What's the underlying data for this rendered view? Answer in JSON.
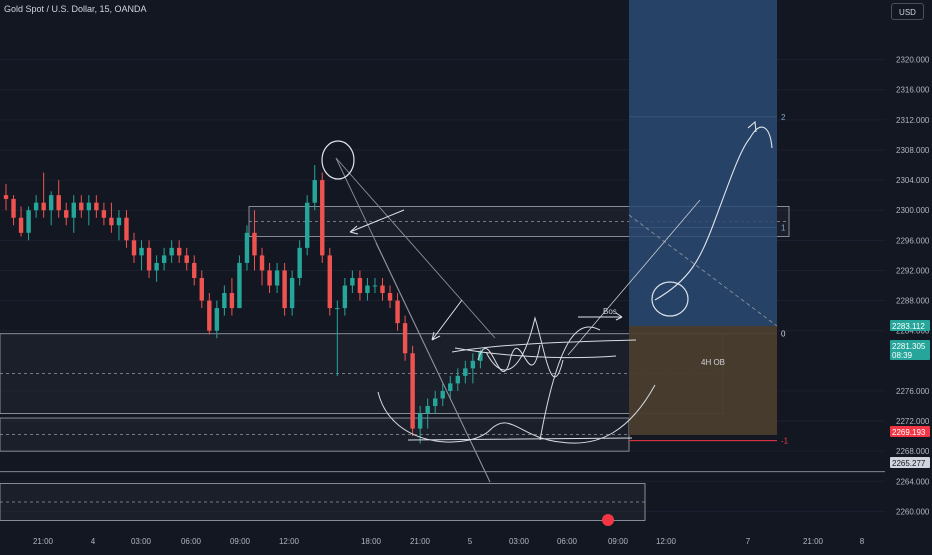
{
  "header": {
    "symbol_title": "Gold Spot / U.S. Dollar, 15, OANDA",
    "currency": "USD"
  },
  "chart_data": {
    "type": "candlestick",
    "title": "Gold Spot / U.S. Dollar, 15, OANDA",
    "y_axis": {
      "ticks": [
        "2320.000",
        "2316.000",
        "2312.000",
        "2308.000",
        "2304.000",
        "2300.000",
        "2296.000",
        "2292.000",
        "2288.000",
        "2284.000",
        "2276.000",
        "2272.000",
        "2268.000",
        "2264.000",
        "2260.000"
      ],
      "ylim": [
        2257,
        2325
      ]
    },
    "x_axis": {
      "ticks": [
        "21:00",
        "4",
        "03:00",
        "06:00",
        "09:00",
        "12:00",
        "18:00",
        "21:00",
        "5",
        "03:00",
        "06:00",
        "09:00",
        "12:00",
        "7",
        "21:00",
        "8"
      ]
    },
    "price_badges": [
      {
        "label": "2283.112",
        "color": "#26a69a"
      },
      {
        "label": "2281.305",
        "sub": "08:39",
        "color": "#26a69a"
      },
      {
        "label": "2269.193",
        "color": "#f23645"
      },
      {
        "label": "2265.277",
        "color": "#d1d4dc"
      }
    ],
    "candles": [
      [
        2302,
        2303.5,
        2300,
        2301.5
      ],
      [
        2301.5,
        2302,
        2298,
        2299
      ],
      [
        2299,
        2300.5,
        2296.5,
        2297
      ],
      [
        2297,
        2300.5,
        2296,
        2300
      ],
      [
        2300,
        2302,
        2299,
        2301
      ],
      [
        2301,
        2305,
        2299,
        2300
      ],
      [
        2300,
        2302.5,
        2298,
        2302
      ],
      [
        2302,
        2304,
        2299,
        2300
      ],
      [
        2300,
        2301,
        2298,
        2299
      ],
      [
        2299,
        2302,
        2297,
        2301
      ],
      [
        2301,
        2302,
        2299,
        2300
      ],
      [
        2300,
        2302,
        2298,
        2301
      ],
      [
        2301,
        2302,
        2299,
        2300
      ],
      [
        2300,
        2301,
        2298,
        2299
      ],
      [
        2299,
        2301,
        2297,
        2298
      ],
      [
        2298,
        2300,
        2296,
        2299
      ],
      [
        2299,
        2300,
        2295,
        2296
      ],
      [
        2296,
        2297,
        2293,
        2294
      ],
      [
        2294,
        2296,
        2292,
        2295
      ],
      [
        2295,
        2296,
        2291,
        2292
      ],
      [
        2292,
        2294,
        2290.5,
        2293
      ],
      [
        2293,
        2295,
        2292,
        2294
      ],
      [
        2294,
        2296,
        2293,
        2295
      ],
      [
        2295,
        2296,
        2293,
        2294
      ],
      [
        2294,
        2295,
        2292,
        2293
      ],
      [
        2293,
        2294,
        2290,
        2291
      ],
      [
        2291,
        2292,
        2287,
        2288
      ],
      [
        2288,
        2289,
        2283.5,
        2284
      ],
      [
        2284,
        2288,
        2283,
        2287
      ],
      [
        2287,
        2290,
        2286,
        2289
      ],
      [
        2289,
        2291,
        2286,
        2287
      ],
      [
        2287,
        2294,
        2287,
        2293
      ],
      [
        2293,
        2298,
        2292,
        2297
      ],
      [
        2297,
        2300,
        2292,
        2294
      ],
      [
        2294,
        2295,
        2290,
        2292
      ],
      [
        2292,
        2293,
        2289,
        2290
      ],
      [
        2290,
        2293,
        2289,
        2292
      ],
      [
        2292,
        2293,
        2286,
        2287
      ],
      [
        2287,
        2292,
        2286,
        2291
      ],
      [
        2291,
        2296,
        2290,
        2295
      ],
      [
        2295,
        2302,
        2294,
        2301
      ],
      [
        2301,
        2306,
        2300,
        2304
      ],
      [
        2304,
        2305,
        2293,
        2294
      ],
      [
        2294,
        2295,
        2286,
        2287
      ],
      [
        2287,
        2288,
        2278,
        2287
      ],
      [
        2287,
        2291,
        2286,
        2290
      ],
      [
        2290,
        2292,
        2289,
        2291
      ],
      [
        2291,
        2292,
        2288,
        2289
      ],
      [
        2289,
        2291,
        2288,
        2290
      ],
      [
        2290,
        2291,
        2289,
        2290
      ],
      [
        2290,
        2291,
        2288,
        2289
      ],
      [
        2289,
        2290,
        2287,
        2288
      ],
      [
        2288,
        2289,
        2284,
        2285
      ],
      [
        2285,
        2286,
        2280,
        2281
      ],
      [
        2281,
        2282,
        2270,
        2271
      ],
      [
        2271,
        2274,
        2269,
        2273
      ],
      [
        2273,
        2275,
        2271,
        2274
      ],
      [
        2274,
        2276,
        2273,
        2275
      ],
      [
        2275,
        2277,
        2274,
        2276
      ],
      [
        2276,
        2278,
        2275,
        2277
      ],
      [
        2277,
        2279,
        2276,
        2278
      ],
      [
        2278,
        2280,
        2277,
        2279
      ],
      [
        2279,
        2281,
        2277,
        2280
      ],
      [
        2280,
        2281.5,
        2279,
        2281.3
      ]
    ],
    "drawings": {
      "zones": [
        {
          "y1": 2296.5,
          "y2": 2300.5
        },
        {
          "y1": 2273,
          "y2": 2283.6
        },
        {
          "y1": 2268,
          "y2": 2272.4
        },
        {
          "y1": 2258.8,
          "y2": 2263.7
        }
      ],
      "fib_levels": [
        {
          "label": "2",
          "value": 2312.4
        },
        {
          "label": "1",
          "value": 2297.7
        },
        {
          "label": "0",
          "value": 2283.6
        },
        {
          "label": "-1",
          "value": 2269.4
        }
      ],
      "annotations": [
        "Bos",
        "4H OB"
      ]
    }
  }
}
